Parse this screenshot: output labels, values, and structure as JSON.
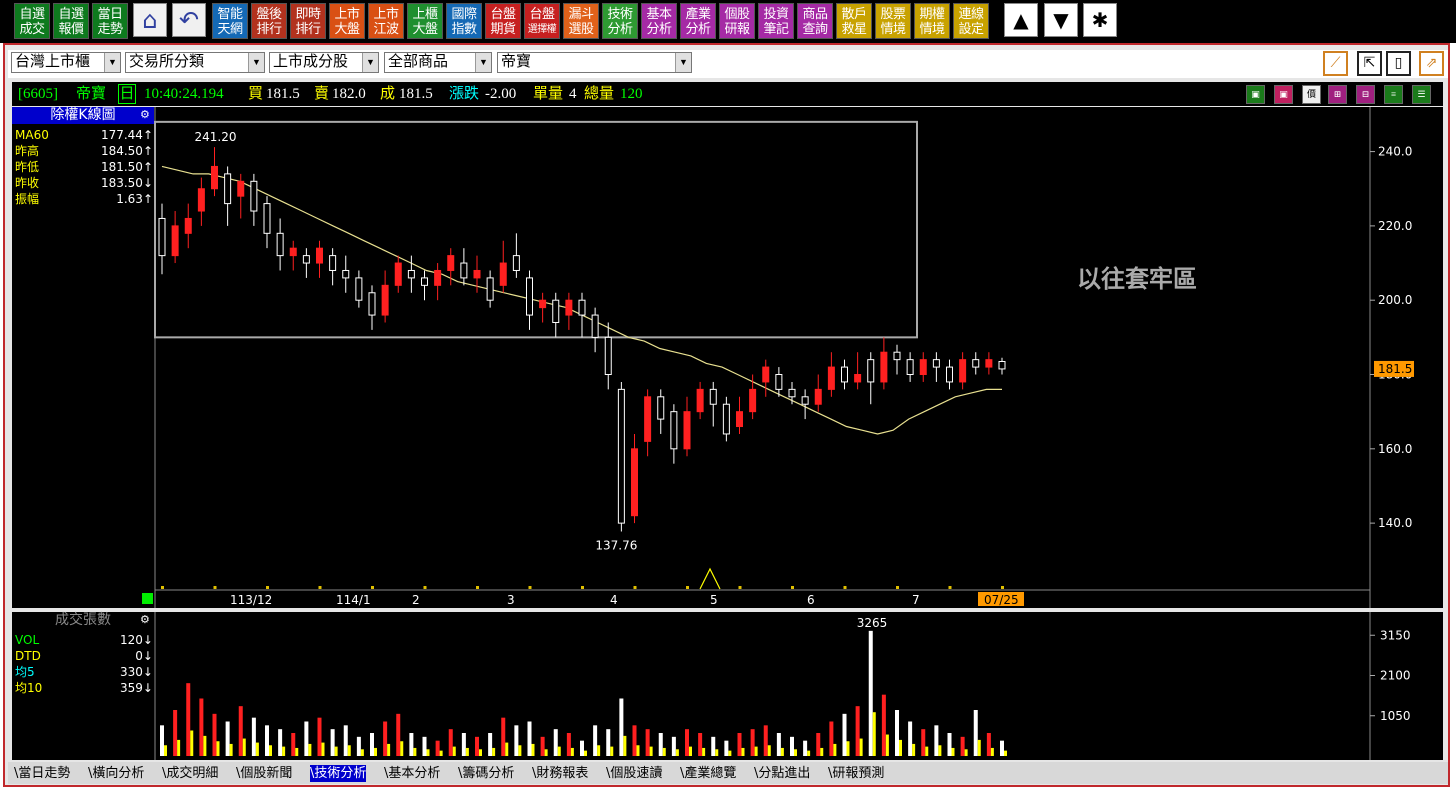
{
  "toolbar": {
    "buttons": [
      {
        "l1": "自選",
        "l2": "成交",
        "bg": "#0e7a1e"
      },
      {
        "l1": "自選",
        "l2": "報價",
        "bg": "#0e7a1e"
      },
      {
        "l1": "當日",
        "l2": "走勢",
        "bg": "#0e7a1e"
      },
      {
        "l1": "智能",
        "l2": "天網",
        "bg": "#1469b5"
      },
      {
        "l1": "盤後",
        "l2": "排行",
        "bg": "#b2321e"
      },
      {
        "l1": "即時",
        "l2": "排行",
        "bg": "#b2321e"
      },
      {
        "l1": "上市",
        "l2": "大盤",
        "bg": "#d95014"
      },
      {
        "l1": "上市",
        "l2": "江波",
        "bg": "#d95014"
      },
      {
        "l1": "上櫃",
        "l2": "大盤",
        "bg": "#1f8f2f"
      },
      {
        "l1": "國際",
        "l2": "指數",
        "bg": "#1469b5"
      },
      {
        "l1": "台盤",
        "l2": "期貨",
        "bg": "#c62020"
      },
      {
        "l1": "台盤",
        "l2": "選擇權",
        "bg": "#c62020"
      },
      {
        "l1": "漏斗",
        "l2": "選股",
        "bg": "#e0611a"
      },
      {
        "l1": "技術",
        "l2": "分析",
        "bg": "#2e9a32"
      },
      {
        "l1": "基本",
        "l2": "分析",
        "bg": "#a52aa5"
      },
      {
        "l1": "產業",
        "l2": "分析",
        "bg": "#a52aa5"
      },
      {
        "l1": "個股",
        "l2": "研報",
        "bg": "#a52aa5"
      },
      {
        "l1": "投資",
        "l2": "筆記",
        "bg": "#a52aa5"
      },
      {
        "l1": "商品",
        "l2": "查詢",
        "bg": "#a52aa5"
      },
      {
        "l1": "散戶",
        "l2": "救星",
        "bg": "#c8a200"
      },
      {
        "l1": "股票",
        "l2": "情境",
        "bg": "#c8a200"
      },
      {
        "l1": "期權",
        "l2": "情境",
        "bg": "#c8a200"
      },
      {
        "l1": "連線",
        "l2": "設定",
        "bg": "#c8a200"
      }
    ],
    "icons": [
      {
        "name": "home-icon",
        "glyph": "⌂"
      },
      {
        "name": "back-icon",
        "glyph": "↶"
      },
      {
        "name": "up-arrow-icon",
        "glyph": "▲"
      },
      {
        "name": "down-arrow-icon",
        "glyph": "▼"
      },
      {
        "name": "asterisk-icon",
        "glyph": "✱"
      }
    ]
  },
  "selectors": {
    "market": "台灣上市櫃",
    "category": "交易所分類",
    "group": "上市成分股",
    "product": "全部商品",
    "stock": "帝寶"
  },
  "quote": {
    "code": "[6605]",
    "name": "帝寶",
    "period": "日",
    "time": "10:40:24.194",
    "bid_label": "買",
    "bid": "181.5",
    "ask_label": "賣",
    "ask": "182.0",
    "last_label": "成",
    "last": "181.5",
    "change_label": "漲跌",
    "change": "-2.00",
    "single_vol_label": "單量",
    "single_vol": "4",
    "total_vol_label": "總量",
    "total_vol": "120"
  },
  "main_panel": {
    "title": "除權K線圖",
    "indicators": [
      {
        "name": "MA60",
        "value": "177.44",
        "arrow": "↑",
        "color": "#ffff00"
      },
      {
        "name": "昨高",
        "value": "184.50",
        "arrow": "↑",
        "color": "#ffff00"
      },
      {
        "name": "昨低",
        "value": "181.50",
        "arrow": "↑",
        "color": "#ffff00"
      },
      {
        "name": "昨收",
        "value": "183.50",
        "arrow": "↓",
        "color": "#ffff00"
      },
      {
        "name": "振幅",
        "value": "1.63",
        "arrow": "↑",
        "color": "#ffff00"
      }
    ]
  },
  "vol_panel": {
    "title": "成交張數",
    "indicators": [
      {
        "name": "VOL",
        "value": "120",
        "arrow": "↓",
        "color": "#00ff00"
      },
      {
        "name": "DTD",
        "value": "0",
        "arrow": "↓",
        "color": "#ffff00"
      },
      {
        "name": "均5",
        "value": "330",
        "arrow": "↓",
        "color": "#00ffff"
      },
      {
        "name": "均10",
        "value": "359",
        "arrow": "↓",
        "color": "#ffff00"
      }
    ]
  },
  "tabs": [
    "當日走勢",
    "橫向分析",
    "成交明細",
    "個股新聞",
    "技術分析",
    "基本分析",
    "籌碼分析",
    "財務報表",
    "個股速讀",
    "產業總覽",
    "分點進出",
    "研報預測"
  ],
  "active_tab": "技術分析",
  "chart_data": [
    {
      "type": "candlestick",
      "title": "除權K線圖",
      "ylim": [
        122,
        252
      ],
      "yticks": [
        140.0,
        160.0,
        180.0,
        200.0,
        220.0,
        240.0
      ],
      "x_tick_labels": [
        "113/12",
        "114/1",
        "2",
        "3",
        "4",
        "5",
        "6",
        "7"
      ],
      "current_date_label": "07/25",
      "current_price_label": "181.5",
      "high_label": "241.20",
      "low_label": "137.76",
      "annotation": "以往套牢區",
      "box_yrange": [
        190,
        248
      ],
      "up_color": "#ff2020",
      "down_color": "#ffffff",
      "ma60": [
        236,
        235,
        234,
        234,
        233,
        232,
        230,
        228,
        226,
        224,
        222,
        220,
        218,
        216,
        214,
        212,
        210,
        208,
        207,
        205,
        204,
        203,
        202,
        201,
        200,
        199,
        198,
        196,
        194,
        192,
        190,
        189,
        187,
        186,
        185,
        183,
        182,
        180,
        178,
        176,
        174,
        172,
        170,
        168,
        166,
        165,
        164,
        165,
        168,
        170,
        172,
        174,
        175,
        176,
        176
      ],
      "ma60_start": 0,
      "ma60_end": 136,
      "candles": [
        [
          222,
          212,
          226,
          207
        ],
        [
          212,
          220,
          224,
          210
        ],
        [
          218,
          222,
          226,
          214
        ],
        [
          224,
          230,
          233,
          220
        ],
        [
          230,
          236,
          241.2,
          228
        ],
        [
          234,
          226,
          236,
          220
        ],
        [
          228,
          232,
          234,
          222
        ],
        [
          232,
          224,
          234,
          220
        ],
        [
          226,
          218,
          228,
          214
        ],
        [
          218,
          212,
          222,
          208
        ],
        [
          212,
          214,
          216,
          208
        ],
        [
          212,
          210,
          214,
          206
        ],
        [
          210,
          214,
          216,
          206
        ],
        [
          212,
          208,
          214,
          204
        ],
        [
          208,
          206,
          212,
          202
        ],
        [
          206,
          200,
          208,
          198
        ],
        [
          202,
          196,
          204,
          192
        ],
        [
          196,
          204,
          208,
          194
        ],
        [
          204,
          210,
          212,
          202
        ],
        [
          208,
          206,
          212,
          202
        ],
        [
          206,
          204,
          208,
          200
        ],
        [
          204,
          208,
          210,
          200
        ],
        [
          208,
          212,
          214,
          204
        ],
        [
          210,
          206,
          214,
          204
        ],
        [
          206,
          208,
          212,
          202
        ],
        [
          206,
          200,
          208,
          198
        ],
        [
          204,
          210,
          216,
          202
        ],
        [
          212,
          208,
          218,
          206
        ],
        [
          206,
          196,
          208,
          192
        ],
        [
          198,
          200,
          202,
          194
        ],
        [
          200,
          194,
          202,
          190
        ],
        [
          196,
          200,
          202,
          192
        ],
        [
          200,
          196,
          202,
          190
        ],
        [
          196,
          190,
          198,
          186
        ],
        [
          190,
          180,
          194,
          176
        ],
        [
          176,
          140,
          178,
          137.76
        ],
        [
          142,
          160,
          164,
          140
        ],
        [
          162,
          174,
          176,
          158
        ],
        [
          174,
          168,
          176,
          164
        ],
        [
          170,
          160,
          172,
          156
        ],
        [
          160,
          170,
          174,
          158
        ],
        [
          170,
          176,
          178,
          168
        ],
        [
          176,
          172,
          178,
          166
        ],
        [
          172,
          164,
          174,
          162
        ],
        [
          166,
          170,
          174,
          164
        ],
        [
          170,
          176,
          180,
          168
        ],
        [
          178,
          182,
          184,
          174
        ],
        [
          180,
          176,
          182,
          174
        ],
        [
          176,
          174,
          178,
          172
        ],
        [
          174,
          172,
          176,
          168
        ],
        [
          172,
          176,
          180,
          170
        ],
        [
          176,
          182,
          186,
          174
        ],
        [
          182,
          178,
          184,
          176
        ],
        [
          178,
          180,
          186,
          176
        ],
        [
          184,
          178,
          186,
          172
        ],
        [
          178,
          186,
          190,
          176
        ],
        [
          186,
          184,
          188,
          180
        ],
        [
          184,
          180,
          186,
          178
        ],
        [
          180,
          184,
          186,
          178
        ],
        [
          184,
          182,
          186,
          178
        ],
        [
          182,
          178,
          184,
          176
        ],
        [
          178,
          184,
          186,
          176
        ],
        [
          184,
          182,
          186,
          180
        ],
        [
          182,
          184,
          186,
          180
        ],
        [
          183.5,
          181.5,
          184.5,
          180
        ]
      ],
      "candle_stride": 2,
      "box_candle_end": 112
    },
    {
      "type": "bar",
      "title": "成交張數",
      "ylim": [
        0,
        3600
      ],
      "yticks": [
        1050,
        2100,
        3150
      ],
      "peak_label": "3265",
      "up_color": "#ff2020",
      "down_color": "#ffffff",
      "ma_color": "#ffff00"
    }
  ]
}
